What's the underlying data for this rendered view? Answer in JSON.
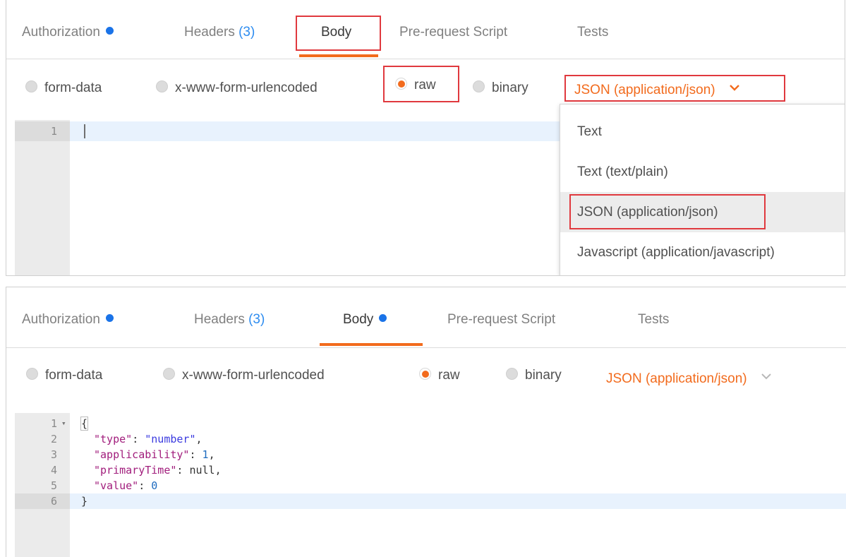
{
  "colors": {
    "accent": "#f26b1d",
    "dot_blue": "#1a73e8",
    "count_blue": "#2d8cf0",
    "highlight": "#e0393e"
  },
  "panel1": {
    "tabs": [
      {
        "label": "Authorization",
        "dot": true
      },
      {
        "label": "Headers",
        "count": "(3)"
      },
      {
        "label": "Body",
        "active": true
      },
      {
        "label": "Pre-request Script"
      },
      {
        "label": "Tests"
      }
    ],
    "body_types": [
      "form-data",
      "x-www-form-urlencoded",
      "raw",
      "binary"
    ],
    "selected_body_type": "raw",
    "content_type": "JSON (application/json)",
    "chevron_icon": "chevron-down-icon",
    "editor_lines": [
      "1"
    ],
    "dropdown": {
      "items": [
        "Text",
        "Text (text/plain)",
        "JSON (application/json)",
        "Javascript (application/javascript)"
      ],
      "selected": "JSON (application/json)"
    }
  },
  "panel2": {
    "tabs": [
      {
        "label": "Authorization",
        "dot": true
      },
      {
        "label": "Headers",
        "count": "(3)"
      },
      {
        "label": "Body",
        "active": true,
        "dot": true
      },
      {
        "label": "Pre-request Script"
      },
      {
        "label": "Tests"
      }
    ],
    "body_types": [
      "form-data",
      "x-www-form-urlencoded",
      "raw",
      "binary"
    ],
    "selected_body_type": "raw",
    "content_type": "JSON (application/json)",
    "chevron_icon": "chevron-down-icon",
    "editor": {
      "line_numbers": [
        "1",
        "2",
        "3",
        "4",
        "5",
        "6"
      ],
      "open_brace": "{",
      "close_brace": "}",
      "json": [
        {
          "key": "\"type\"",
          "sep": ": ",
          "value": "\"number\"",
          "value_kind": "string",
          "trail": ","
        },
        {
          "key": "\"applicability\"",
          "sep": ": ",
          "value": "1",
          "value_kind": "number",
          "trail": ","
        },
        {
          "key": "\"primaryTime\"",
          "sep": ": ",
          "value": "null",
          "value_kind": "null",
          "trail": ","
        },
        {
          "key": "\"value\"",
          "sep": ": ",
          "value": "0",
          "value_kind": "number",
          "trail": ""
        }
      ]
    }
  }
}
